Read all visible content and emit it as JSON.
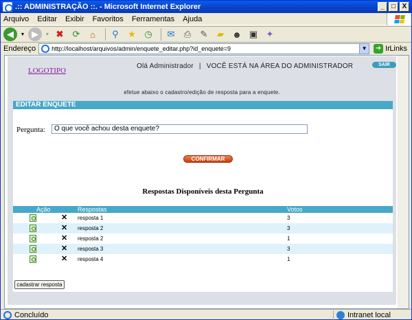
{
  "window": {
    "title": ".:: ADMINISTRAÇÃO ::. - Microsoft Internet Explorer",
    "controls": {
      "minimize": "_",
      "maximize": "□",
      "close": "X"
    }
  },
  "menu": [
    "Arquivo",
    "Editar",
    "Exibir",
    "Favoritos",
    "Ferramentas",
    "Ajuda"
  ],
  "toolbar": {
    "icons": [
      "back-icon",
      "forward-icon",
      "stop-icon",
      "refresh-icon",
      "home-icon",
      "search-icon",
      "favorites-icon",
      "history-icon",
      "mail-icon",
      "print-icon",
      "edit-icon",
      "folder-icon",
      "messenger-icon",
      "research-icon",
      "tools-icon"
    ]
  },
  "address": {
    "label": "Endereço",
    "url": "http://localhost/arquivos/admin/enquete_editar.php?id_enquete=9",
    "go_label": "Ir",
    "links_label": "Links"
  },
  "page": {
    "logo": "LOGOTIPO",
    "greeting": "Olá Administrador",
    "area_text": "VOCÊ ESTÁ NA ÁREA DO ADMINISTRADOR",
    "logout_label": "SAIR",
    "hint": "efetue abaixo o cadastro/edição de resposta para a enquete.",
    "section_title": "EDITAR ENQUETE",
    "question_label": "Pergunta:",
    "question_value": "O que você achou desta enquete?",
    "confirm_label": "CONFIRMAR",
    "answers_title": "Respostas Disponíveis desta Pergunta",
    "table_headers": {
      "action": "Ação",
      "answers": "Respostas",
      "votes": "Votos"
    },
    "answers": [
      {
        "name": "resposta 1",
        "votes": "3"
      },
      {
        "name": "resposta 2",
        "votes": "3"
      },
      {
        "name": "resposta 2",
        "votes": "1"
      },
      {
        "name": "resposta 3",
        "votes": "3"
      },
      {
        "name": "resposta 4",
        "votes": "1"
      }
    ],
    "add_answer_label": "cadastrar resposta"
  },
  "status": {
    "left_text": "Concluído",
    "zone_text": "Intranet local"
  },
  "colors": {
    "accent": "#47a8c7",
    "logo_link": "#8a1aa0",
    "confirm_button": "#d9541c"
  }
}
